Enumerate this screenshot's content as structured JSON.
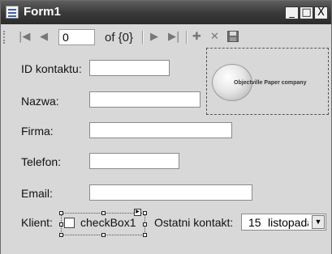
{
  "window": {
    "title": "Form1",
    "minimize_glyph": "_",
    "maximize_glyph": "□",
    "close_glyph": "X"
  },
  "navigator": {
    "position_value": "0",
    "count_label": "of {0}",
    "icons": {
      "first": "move-first-icon",
      "previous": "move-previous-icon",
      "next": "move-next-icon",
      "last": "move-last-icon",
      "add": "add-new-icon",
      "delete": "delete-icon",
      "save": "save-icon"
    }
  },
  "form": {
    "id_label": "ID kontaktu:",
    "name_label": "Nazwa:",
    "company_label": "Firma:",
    "phone_label": "Telefon:",
    "email_label": "Email:",
    "client_label": "Klient:",
    "checkbox_text": "checkBox1",
    "last_contact_label": "Ostatni kontakt:",
    "last_contact_day": "15",
    "last_contact_month": "listopada"
  },
  "picture": {
    "company_text": "Objectville Paper company"
  },
  "colors": {
    "titlebar": "#3a3a3a",
    "form_background": "#d8d8d8"
  }
}
